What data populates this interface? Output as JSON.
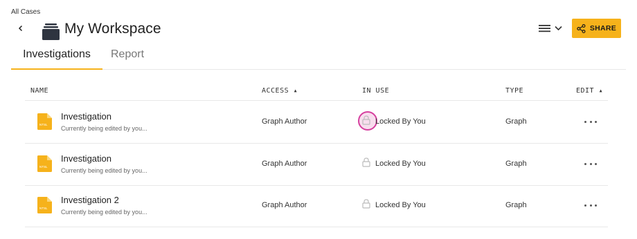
{
  "breadcrumb": "All Cases",
  "title": "My Workspace",
  "share_label": "SHARE",
  "tabs": [
    {
      "label": "Investigations",
      "active": true
    },
    {
      "label": "Report",
      "active": false
    }
  ],
  "columns": {
    "name": "NAME",
    "access": "ACCESS ▴",
    "in_use": "IN USE",
    "type": "TYPE",
    "edit": "EDIT ▴"
  },
  "icon_label": "NTSL",
  "rows": [
    {
      "name": "Investigation",
      "subtitle": "Currently being edited by you...",
      "access": "Graph Author",
      "in_use": "Locked By You",
      "type": "Graph"
    },
    {
      "name": "Investigation",
      "subtitle": "Currently being edited by you...",
      "access": "Graph Author",
      "in_use": "Locked By You",
      "type": "Graph"
    },
    {
      "name": "Investigation 2",
      "subtitle": "Currently being edited by you...",
      "access": "Graph Author",
      "in_use": "Locked By You",
      "type": "Graph"
    }
  ],
  "colors": {
    "accent": "#f6b21b",
    "highlight": "#d6409f"
  },
  "icons": [
    "chevron-left-icon",
    "workspace-stack-icon",
    "hamburger-menu-icon",
    "chevron-down-icon",
    "share-icon",
    "document-icon",
    "lock-icon",
    "more-options-icon"
  ]
}
